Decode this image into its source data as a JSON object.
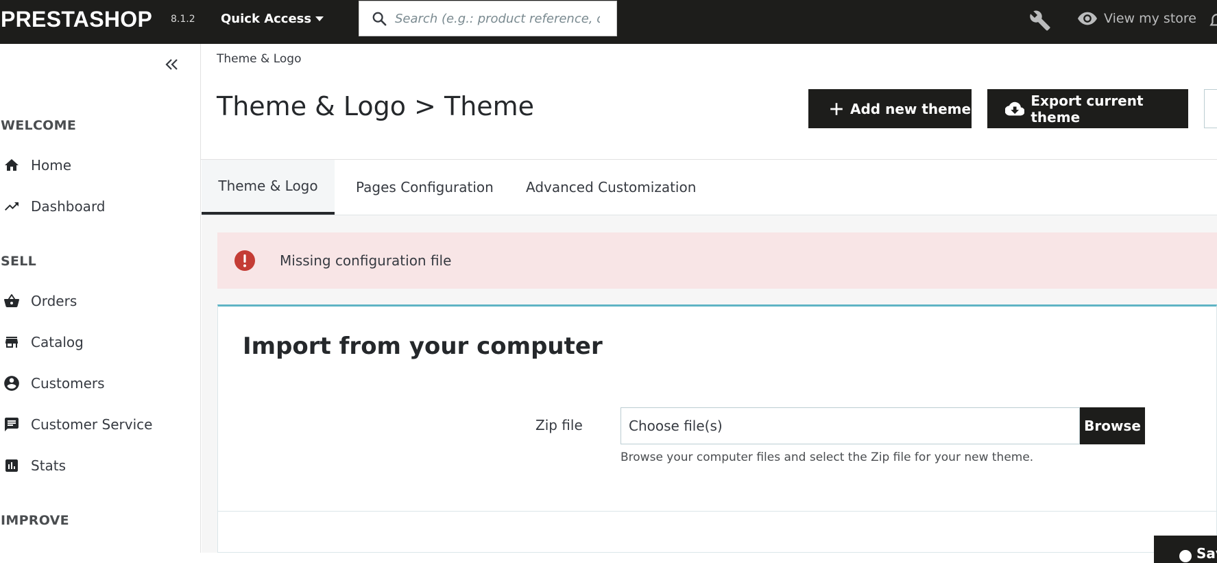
{
  "header": {
    "logo": "PRESTASHOP",
    "version": "8.1.2",
    "quick_access": "Quick Access",
    "search_placeholder": "Search (e.g.: product reference, customer name…)",
    "view_store": "View my store"
  },
  "sidebar": {
    "sections": [
      {
        "label": "WELCOME",
        "items": [
          {
            "label": "Home",
            "icon": "home-icon"
          },
          {
            "label": "Dashboard",
            "icon": "trending-up-icon"
          }
        ]
      },
      {
        "label": "SELL",
        "items": [
          {
            "label": "Orders",
            "icon": "basket-icon"
          },
          {
            "label": "Catalog",
            "icon": "store-icon"
          },
          {
            "label": "Customers",
            "icon": "account-circle-icon"
          },
          {
            "label": "Customer Service",
            "icon": "chat-icon"
          },
          {
            "label": "Stats",
            "icon": "bar-chart-icon"
          }
        ]
      },
      {
        "label": "IMPROVE",
        "items": []
      }
    ]
  },
  "page": {
    "breadcrumb": "Theme & Logo",
    "title": "Theme & Logo > Theme",
    "add_theme": "Add new theme",
    "export_theme": "Export current theme"
  },
  "tabs": [
    {
      "label": "Theme & Logo",
      "active": true
    },
    {
      "label": "Pages Configuration",
      "active": false
    },
    {
      "label": "Advanced Customization",
      "active": false
    }
  ],
  "alert": {
    "message": "Missing configuration file",
    "color": "#c43c35"
  },
  "import_card": {
    "title": "Import from your computer",
    "zip_label": "Zip file",
    "file_placeholder": "Choose file(s)",
    "browse": "Browse",
    "help": "Browse your computer files and select the Zip file for your new theme.",
    "save": "Save"
  },
  "colors": {
    "topbar": "#1d1d1b",
    "accent": "#5fb4c4",
    "alert_bg": "#f8e5e6"
  }
}
